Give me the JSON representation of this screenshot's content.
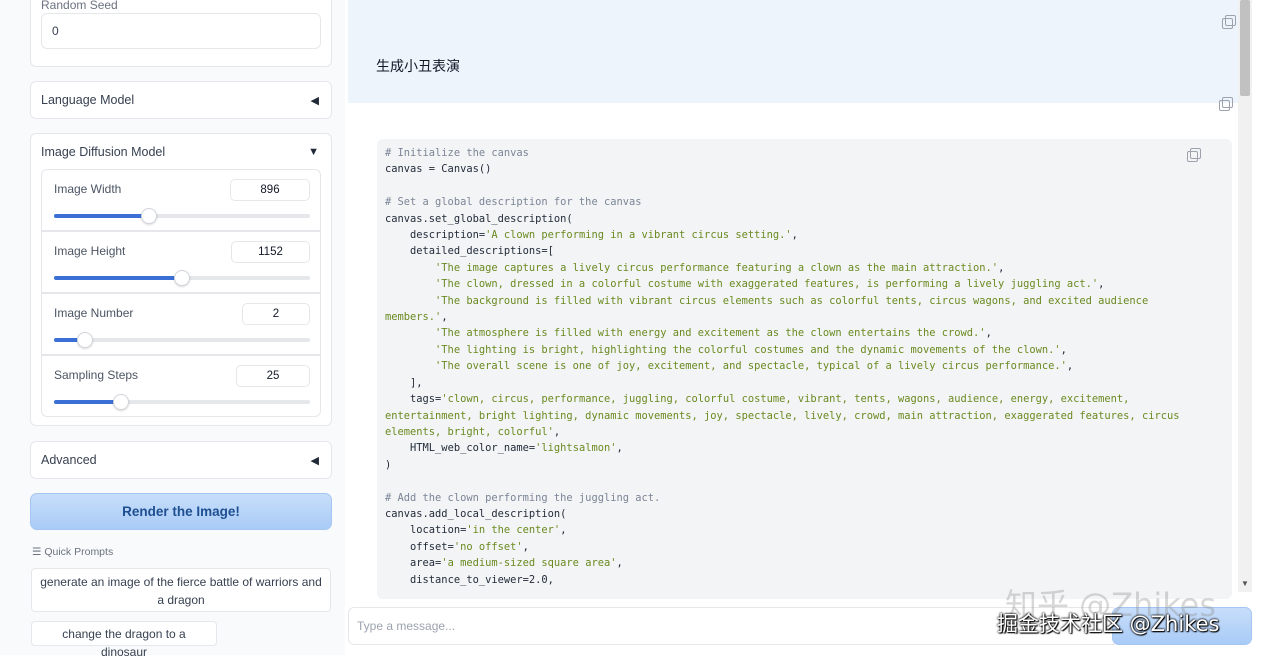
{
  "sidebar": {
    "seed_label": "Random Seed",
    "seed_value": "0",
    "language_model_label": "Language Model",
    "image_diffusion_label": "Image Diffusion Model",
    "advanced_label": "Advanced",
    "sliders": [
      {
        "label": "Image Width",
        "value": "896",
        "fraction": 0.37
      },
      {
        "label": "Image Height",
        "value": "1152",
        "fraction": 0.5
      },
      {
        "label": "Image Number",
        "value": "2",
        "fraction": 0.12
      },
      {
        "label": "Sampling Steps",
        "value": "25",
        "fraction": 0.26
      }
    ],
    "render_button": "Render the Image!",
    "quick_prompts_title": "Quick Prompts",
    "quick_prompts": [
      "generate an image of the fierce battle of warriors and a dragon",
      "change the dragon to a dinosaur"
    ]
  },
  "chat": {
    "user_message": "生成小丑表演",
    "input_placeholder": "Type a message...",
    "code_lines": [
      [
        [
          "c",
          "# Initialize the canvas"
        ]
      ],
      [
        [
          "n",
          "canvas = Canvas()"
        ]
      ],
      [
        [
          "n",
          ""
        ]
      ],
      [
        [
          "c",
          "# Set a global description for the canvas"
        ]
      ],
      [
        [
          "n",
          "canvas.set_global_description("
        ]
      ],
      [
        [
          "n",
          "    description="
        ],
        [
          "s",
          "'A clown performing in a vibrant circus setting.'"
        ],
        [
          "n",
          ","
        ]
      ],
      [
        [
          "n",
          "    detailed_descriptions=["
        ]
      ],
      [
        [
          "n",
          "        "
        ],
        [
          "s",
          "'The image captures a lively circus performance featuring a clown as the main attraction.'"
        ],
        [
          "n",
          ","
        ]
      ],
      [
        [
          "n",
          "        "
        ],
        [
          "s",
          "'The clown, dressed in a colorful costume with exaggerated features, is performing a lively juggling act.'"
        ],
        [
          "n",
          ","
        ]
      ],
      [
        [
          "n",
          "        "
        ],
        [
          "s",
          "'The background is filled with vibrant circus elements such as colorful tents, circus wagons, and excited audience members.'"
        ],
        [
          "n",
          ","
        ]
      ],
      [
        [
          "n",
          "        "
        ],
        [
          "s",
          "'The atmosphere is filled with energy and excitement as the clown entertains the crowd.'"
        ],
        [
          "n",
          ","
        ]
      ],
      [
        [
          "n",
          "        "
        ],
        [
          "s",
          "'The lighting is bright, highlighting the colorful costumes and the dynamic movements of the clown.'"
        ],
        [
          "n",
          ","
        ]
      ],
      [
        [
          "n",
          "        "
        ],
        [
          "s",
          "'The overall scene is one of joy, excitement, and spectacle, typical of a lively circus performance.'"
        ],
        [
          "n",
          ","
        ]
      ],
      [
        [
          "n",
          "    ],"
        ]
      ],
      [
        [
          "n",
          "    tags="
        ],
        [
          "s",
          "'clown, circus, performance, juggling, colorful costume, vibrant, tents, wagons, audience, energy, excitement, entertainment, bright lighting, dynamic movements, joy, spectacle, lively, crowd, main attraction, exaggerated features, circus elements, bright, colorful'"
        ],
        [
          "n",
          ","
        ]
      ],
      [
        [
          "n",
          "    HTML_web_color_name="
        ],
        [
          "s",
          "'lightsalmon'"
        ],
        [
          "n",
          ","
        ]
      ],
      [
        [
          "n",
          ")"
        ]
      ],
      [
        [
          "n",
          ""
        ]
      ],
      [
        [
          "c",
          "# Add the clown performing the juggling act."
        ]
      ],
      [
        [
          "n",
          "canvas.add_local_description("
        ]
      ],
      [
        [
          "n",
          "    location="
        ],
        [
          "s",
          "'in the center'"
        ],
        [
          "n",
          ","
        ]
      ],
      [
        [
          "n",
          "    offset="
        ],
        [
          "s",
          "'no offset'"
        ],
        [
          "n",
          ","
        ]
      ],
      [
        [
          "n",
          "    area="
        ],
        [
          "s",
          "'a medium-sized square area'"
        ],
        [
          "n",
          ","
        ]
      ],
      [
        [
          "n",
          "    distance_to_viewer=2.0,"
        ]
      ]
    ]
  },
  "watermark": {
    "big": "知乎 @Zhikes",
    "small": "掘金技术社区 @Zhikes"
  }
}
